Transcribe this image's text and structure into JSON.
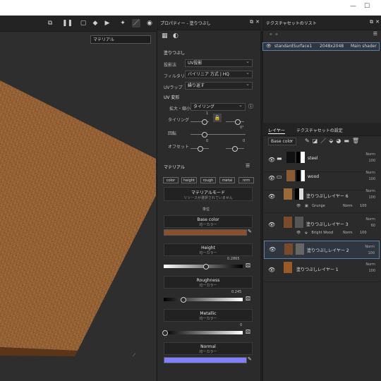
{
  "window": {
    "minimize": "—",
    "maximize": "☐"
  },
  "viewport": {
    "material_select": "マテリアル",
    "tools": [
      "frame-icon",
      "cube-icon",
      "video-icon",
      "light-icon",
      "brush-icon",
      "camera-icon"
    ]
  },
  "properties": {
    "title": "プロパティー - 塗りつぶし",
    "section": "塗りつぶし",
    "projection_label": "投影法",
    "projection_value": "UV投影",
    "filtering_label": "フィルタリング",
    "filtering_value": "バイリニア 方式 | HQ",
    "uvwrap_label": "UVラップ",
    "uvwrap_value": "繰り返す",
    "uv_transform": "UV 変形",
    "scale_mode_label": "拡大・縮小",
    "scale_mode_value": "タイリング",
    "tiling_label": "タイリング",
    "tiling_value": "1",
    "rotation_label": "回転",
    "rotation_value": "0°",
    "offset_label": "オフセット",
    "offset_u": "0",
    "offset_v": "0",
    "material_section": "マテリアル",
    "channels": [
      "color",
      "height",
      "rough",
      "metal",
      "nrm"
    ],
    "material_mode": "マテリアルモード",
    "material_mode_sub": "リソースが選択されていません",
    "unit": "単位",
    "cards": [
      {
        "title": "Base color",
        "sub": "均一カラー",
        "swatch": "#8a4f2c"
      },
      {
        "title": "Height",
        "sub": "均一カラー",
        "value": "0.2865"
      },
      {
        "title": "Roughness",
        "sub": "均一カラー",
        "value": "0.245"
      },
      {
        "title": "Metallic",
        "sub": "均一カラー",
        "value": "0"
      },
      {
        "title": "Normal",
        "sub": "均一カラー",
        "swatch": "#7f7fff"
      }
    ]
  },
  "texture_list": {
    "title": "テクスチャセットのリスト",
    "asset_name": "standardSurface1",
    "asset_res": "2048x2048",
    "asset_shader": "Main shader"
  },
  "layers": {
    "tab_layers": "レイヤー",
    "tab_texset": "テクスチャセットの設定",
    "channel_select": "Base color",
    "items": [
      {
        "name": "steel",
        "blend": "Norm",
        "opacity": "100"
      },
      {
        "name": "wood",
        "blend": "Norm",
        "opacity": "100"
      },
      {
        "name": "塗りつぶしレイヤー 6",
        "blend": "Norm",
        "opacity": "100"
      },
      {
        "name": "塗りつぶしレイヤー 3",
        "blend": "Norm",
        "opacity": "60"
      },
      {
        "name": "塗りつぶしレイヤー 2",
        "blend": "Norm",
        "opacity": "100"
      },
      {
        "name": "塗りつぶしレイヤー 1",
        "blend": "Norm",
        "opacity": "100"
      }
    ],
    "sub_a": {
      "name": "Grunge",
      "blend": "Norm",
      "opacity": "100"
    },
    "sub_b": {
      "name": "Bright Wood",
      "blend": "Norm",
      "opacity": "100"
    }
  }
}
